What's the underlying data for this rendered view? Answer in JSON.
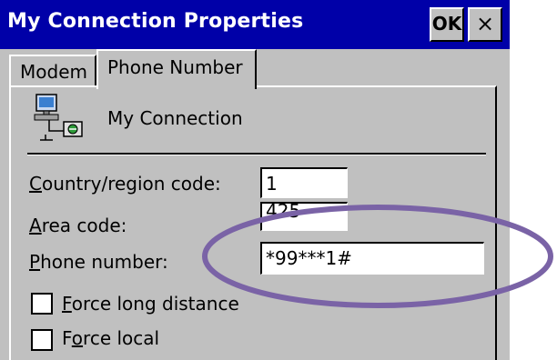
{
  "window": {
    "title": "My Connection Properties",
    "ok_label": "OK",
    "close_label": "×"
  },
  "tabs": [
    {
      "label": "Modem",
      "selected": false
    },
    {
      "label": "Phone Number",
      "selected": true
    }
  ],
  "connection": {
    "icon": "network-connection-icon",
    "name": "My Connection"
  },
  "form": {
    "country_code": {
      "label_first": "C",
      "label_rest": "ountry/region code:",
      "value": "1"
    },
    "area_code": {
      "label_first": "A",
      "label_rest": "rea code:",
      "value": "425"
    },
    "phone_number": {
      "label_first": "P",
      "label_rest": "hone number:",
      "value": "*99***1#"
    },
    "force_long_distance": {
      "label_first": "F",
      "label_rest": "orce long distance",
      "checked": false
    },
    "force_local": {
      "label_pre": "F",
      "label_u": "o",
      "label_rest": "rce local",
      "checked": false
    }
  },
  "highlight": {
    "color": "#7a63a6"
  }
}
